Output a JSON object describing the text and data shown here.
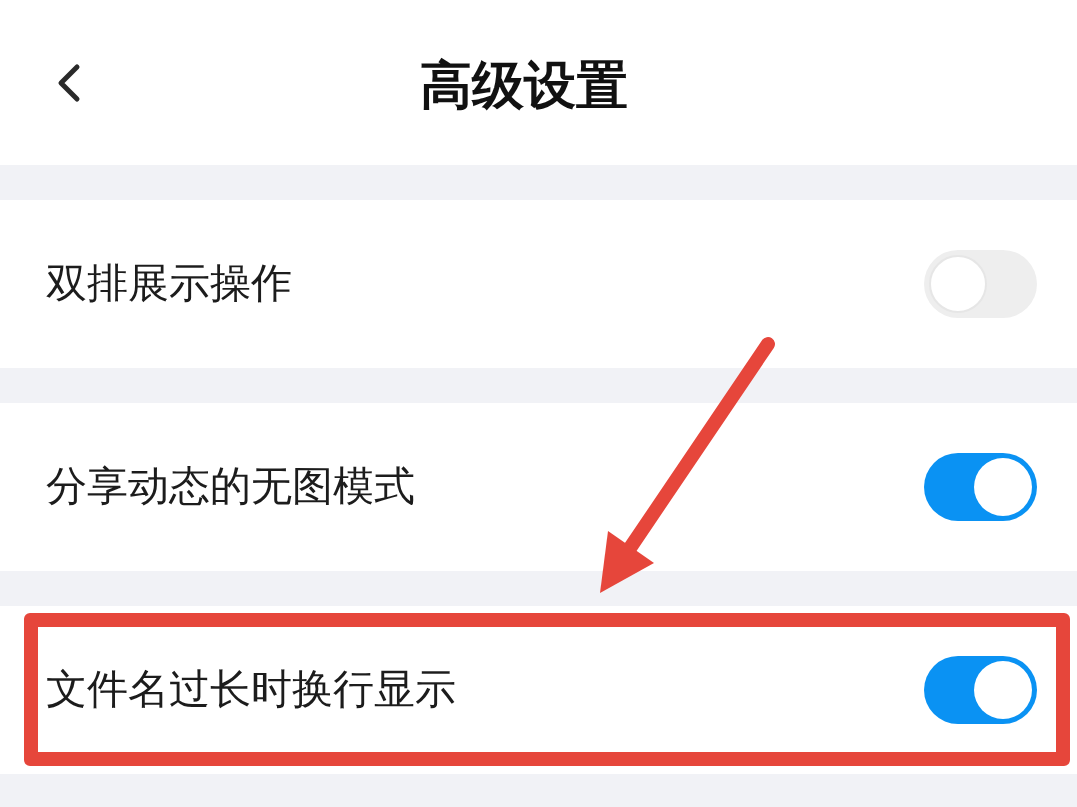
{
  "header": {
    "title": "高级设置"
  },
  "settings": [
    {
      "label": "双排展示操作",
      "on": false,
      "highlighted": false
    },
    {
      "label": "分享动态的无图模式",
      "on": true,
      "highlighted": false
    },
    {
      "label": "文件名过长时换行显示",
      "on": true,
      "highlighted": true
    }
  ]
}
